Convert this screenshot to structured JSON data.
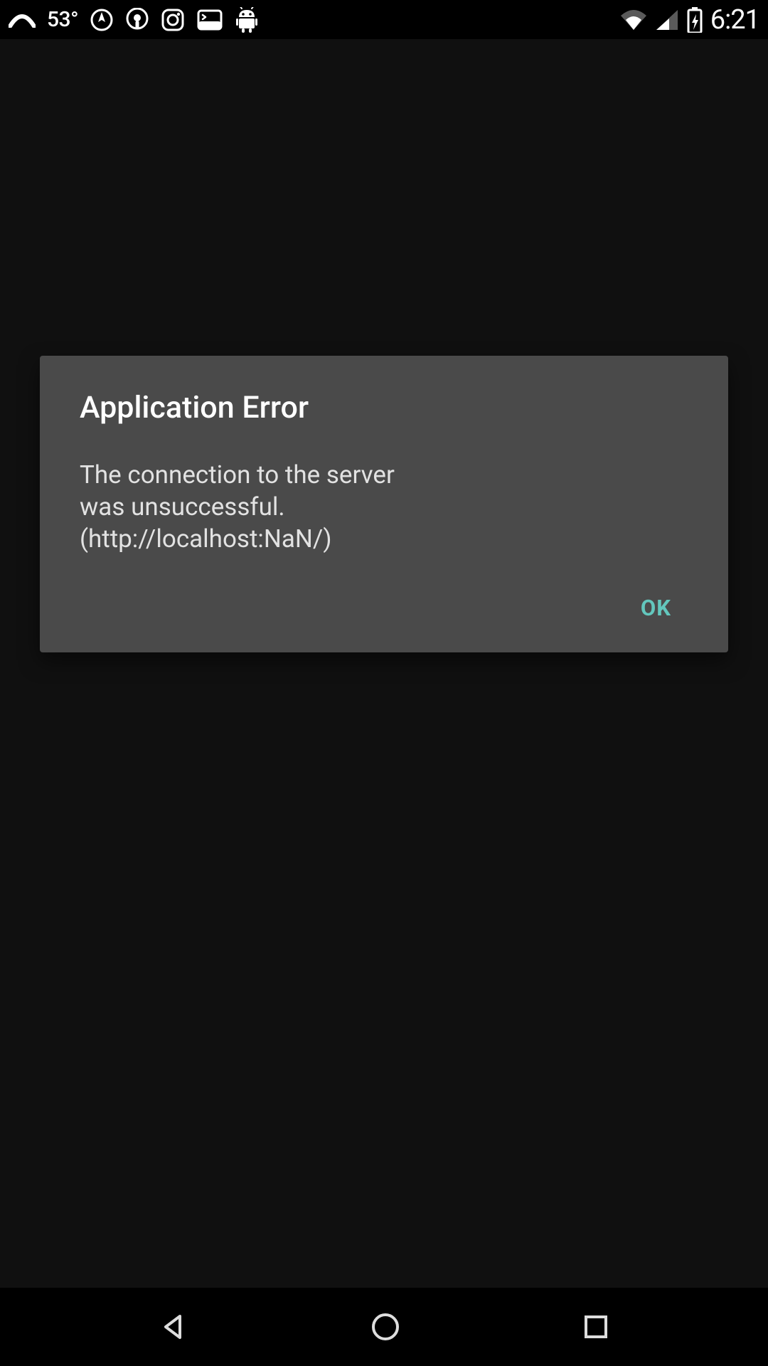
{
  "status_bar": {
    "temperature": "53°",
    "time": "6:21",
    "icons": {
      "cloud": "cloud-icon",
      "location": "location-icon",
      "podcast": "podcast-icon",
      "instagram": "instagram-icon",
      "terminal": "terminal-icon",
      "android": "android-icon",
      "wifi": "wifi-icon",
      "cellular": "cellular-icon",
      "battery": "battery-charging-icon"
    }
  },
  "dialog": {
    "title": "Application Error",
    "message": "The connection to the server was unsuccessful. (http://localhost:NaN/)",
    "ok_label": "OK"
  },
  "colors": {
    "accent": "#63c7bd",
    "dialog_bg": "#4a4a4a",
    "app_bg": "#101010"
  },
  "nav_bar": {
    "back": "back-icon",
    "home": "home-icon",
    "recent": "recent-apps-icon"
  }
}
